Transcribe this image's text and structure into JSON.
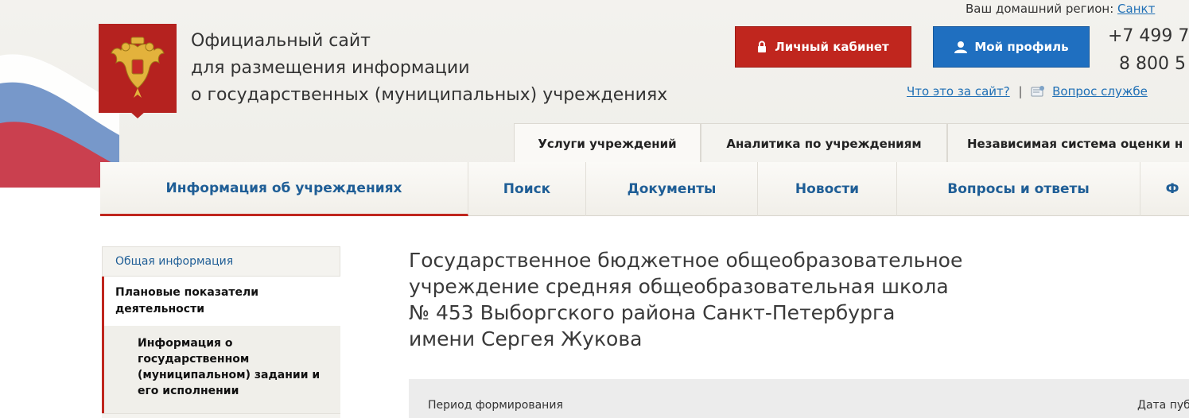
{
  "header": {
    "title_lines": [
      "Официальный сайт",
      "для размещения информации",
      "о государственных (муниципальных) учреждениях"
    ],
    "region_label": "Ваш домашний регион:",
    "region_value": "Санкт",
    "cabinet_button": "Личный кабинет",
    "profile_button": "Мой профиль",
    "phone_1": "+7 499 7",
    "phone_2": "8 800 5",
    "what_is_link": "Что это за сайт?",
    "separator": "|",
    "support_link": "Вопрос службе"
  },
  "top_tabs": [
    "Услуги учреждений",
    "Аналитика по учреждениям",
    "Независимая система оценки н"
  ],
  "main_nav": [
    "Информация об учреждениях",
    "Поиск",
    "Документы",
    "Новости",
    "Вопросы и ответы",
    "Ф"
  ],
  "sidebar": {
    "general": "Общая информация",
    "plan_indicators": "Плановые показатели деятельности",
    "state_task": "Информация о государственном (муниципальном) задании и его исполнении"
  },
  "org_title": "Государственное бюджетное общеобразовательное учреждение средняя общеобразовательная школа № 453 Выборгского района Санкт-Петербурга имени Сергея Жукова",
  "table": {
    "col_period": "Период формирования",
    "col_date": "Дата пуб"
  },
  "colors": {
    "accent_red": "#c0261e",
    "accent_blue": "#1f6fc0",
    "link_blue": "#1f5e96"
  }
}
